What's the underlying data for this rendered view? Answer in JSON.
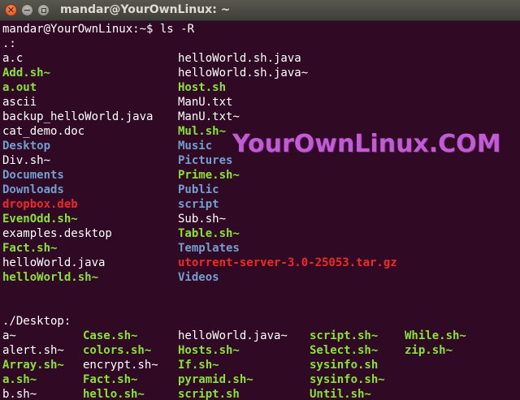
{
  "window": {
    "title": "mandar@YourOwnLinux: ~",
    "close_glyph": "✕",
    "minimize_glyph": "−",
    "maximize_icon": "maximize-icon"
  },
  "terminal": {
    "prompt": "mandar@YourOwnLinux:~$ ls -R",
    "root_header": ".:",
    "desktop_header": "./Desktop:",
    "colors": {
      "background": "#300a24",
      "regular": "#ffffff",
      "executable": "#8ae234",
      "directory": "#729fcf",
      "archive": "#ef2929"
    },
    "root_listing": {
      "col1": [
        {
          "name": "a.c",
          "kind": "reg"
        },
        {
          "name": "Add.sh~",
          "kind": "exe"
        },
        {
          "name": "a.out",
          "kind": "exe"
        },
        {
          "name": "ascii",
          "kind": "reg"
        },
        {
          "name": "backup_helloWorld.java",
          "kind": "reg"
        },
        {
          "name": "cat_demo.doc",
          "kind": "reg"
        },
        {
          "name": "Desktop",
          "kind": "dir"
        },
        {
          "name": "Div.sh~",
          "kind": "reg"
        },
        {
          "name": "Documents",
          "kind": "dir"
        },
        {
          "name": "Downloads",
          "kind": "dir"
        },
        {
          "name": "dropbox.deb",
          "kind": "arc"
        },
        {
          "name": "EvenOdd.sh~",
          "kind": "exe"
        },
        {
          "name": "examples.desktop",
          "kind": "reg"
        },
        {
          "name": "Fact.sh~",
          "kind": "exe"
        },
        {
          "name": "helloWorld.java",
          "kind": "reg"
        },
        {
          "name": "helloWorld.sh~",
          "kind": "exe"
        }
      ],
      "col2": [
        {
          "name": "helloWorld.sh.java",
          "kind": "reg"
        },
        {
          "name": "helloWorld.sh.java~",
          "kind": "reg"
        },
        {
          "name": "Host.sh",
          "kind": "exe"
        },
        {
          "name": "ManU.txt",
          "kind": "reg"
        },
        {
          "name": "ManU.txt~",
          "kind": "reg"
        },
        {
          "name": "Mul.sh~",
          "kind": "exe"
        },
        {
          "name": "Music",
          "kind": "dir"
        },
        {
          "name": "Pictures",
          "kind": "dir"
        },
        {
          "name": "Prime.sh~",
          "kind": "exe"
        },
        {
          "name": "Public",
          "kind": "dir"
        },
        {
          "name": "script",
          "kind": "dir"
        },
        {
          "name": "Sub.sh~",
          "kind": "reg"
        },
        {
          "name": "Table.sh~",
          "kind": "exe"
        },
        {
          "name": "Templates",
          "kind": "dir"
        },
        {
          "name": "utorrent-server-3.0-25053.tar.gz",
          "kind": "arc"
        },
        {
          "name": "Videos",
          "kind": "dir"
        }
      ]
    },
    "desktop_listing": {
      "col1": [
        {
          "name": "a~",
          "kind": "reg"
        },
        {
          "name": "alert.sh~",
          "kind": "reg"
        },
        {
          "name": "Array.sh~",
          "kind": "exe"
        },
        {
          "name": "a.sh~",
          "kind": "exe"
        },
        {
          "name": "b.sh~",
          "kind": "reg"
        }
      ],
      "col2": [
        {
          "name": "Case.sh~",
          "kind": "exe"
        },
        {
          "name": "colors.sh~",
          "kind": "exe"
        },
        {
          "name": "encrypt.sh~",
          "kind": "reg"
        },
        {
          "name": "Fact.sh~",
          "kind": "exe"
        },
        {
          "name": "hello.sh~",
          "kind": "exe"
        }
      ],
      "col3": [
        {
          "name": "helloWorld.java~",
          "kind": "reg"
        },
        {
          "name": "Hosts.sh~",
          "kind": "exe"
        },
        {
          "name": "If.sh~",
          "kind": "exe"
        },
        {
          "name": "pyramid.sh~",
          "kind": "exe"
        },
        {
          "name": "script.sh",
          "kind": "exe"
        }
      ],
      "col4": [
        {
          "name": "script.sh~",
          "kind": "exe"
        },
        {
          "name": "Select.sh~",
          "kind": "exe"
        },
        {
          "name": "sysinfo.sh",
          "kind": "exe"
        },
        {
          "name": "sysinfo.sh~",
          "kind": "exe"
        },
        {
          "name": "Until.sh~",
          "kind": "exe"
        }
      ],
      "col5": [
        {
          "name": "While.sh~",
          "kind": "exe"
        },
        {
          "name": "zip.sh~",
          "kind": "exe"
        }
      ]
    }
  },
  "watermark": {
    "text": "YourOwnLinux.COM"
  }
}
